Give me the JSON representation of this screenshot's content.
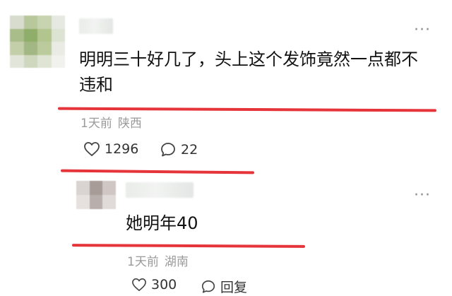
{
  "comment": {
    "text": "明明三十好几了，头上这个发饰竟然一点都不违和",
    "time": "1天前",
    "location": "陕西",
    "likes": "1296",
    "replies": "22"
  },
  "reply": {
    "text": "她明年40",
    "time": "1天前",
    "location": "湖南",
    "likes": "300",
    "replies_label": "回复"
  },
  "icons": [
    "more-icon",
    "heart-icon",
    "comment-icon"
  ],
  "colors": {
    "annotation_red": "#e5353b",
    "meta_gray": "#9a9a9a"
  }
}
